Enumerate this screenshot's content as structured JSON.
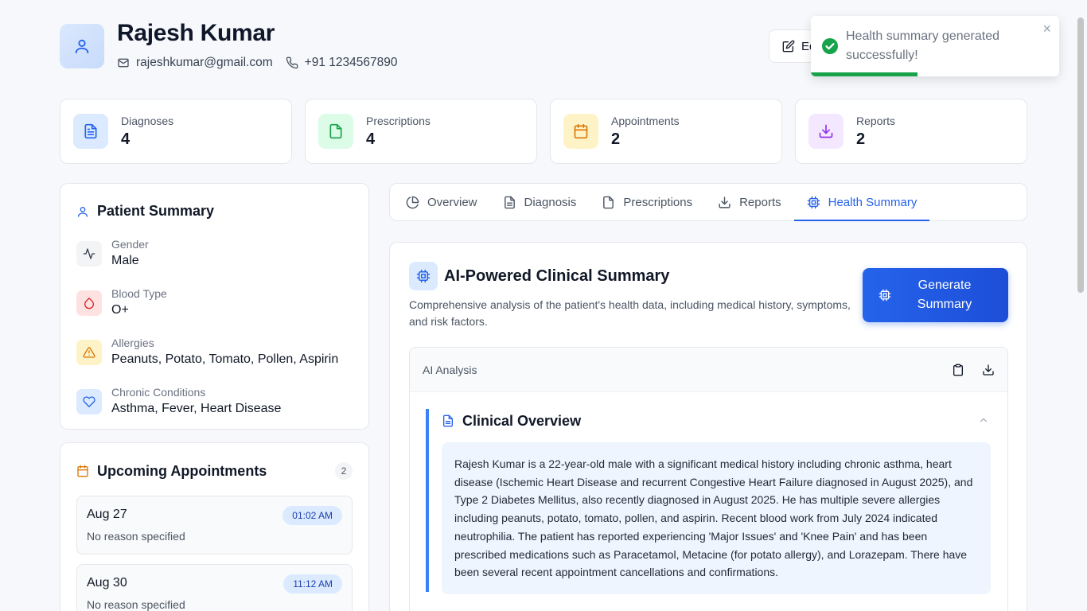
{
  "patient": {
    "name": "Rajesh Kumar",
    "email": "rajeshkumar@gmail.com",
    "phone": "+91 1234567890"
  },
  "header": {
    "edit_label": "Edit"
  },
  "toast": {
    "message": "Health summary generated successfully!",
    "close": "×",
    "progress": 0.43
  },
  "stats": [
    {
      "label": "Diagnoses",
      "value": "4",
      "icon": "file-text-icon"
    },
    {
      "label": "Prescriptions",
      "value": "4",
      "icon": "file-icon"
    },
    {
      "label": "Appointments",
      "value": "2",
      "icon": "calendar-icon"
    },
    {
      "label": "Reports",
      "value": "2",
      "icon": "download-icon"
    }
  ],
  "summary": {
    "title": "Patient Summary",
    "items": [
      {
        "label": "Gender",
        "value": "Male",
        "icon": "activity-icon"
      },
      {
        "label": "Blood Type",
        "value": "O+",
        "icon": "droplet-icon"
      },
      {
        "label": "Allergies",
        "value": "Peanuts, Potato, Tomato, Pollen, Aspirin",
        "icon": "alert-triangle-icon"
      },
      {
        "label": "Chronic Conditions",
        "value": "Asthma, Fever, Heart Disease",
        "icon": "heart-icon"
      }
    ]
  },
  "appointments": {
    "title": "Upcoming Appointments",
    "count": "2",
    "items": [
      {
        "date": "Aug 27",
        "time": "01:02 AM",
        "reason": "No reason specified"
      },
      {
        "date": "Aug 30",
        "time": "11:12 AM",
        "reason": "No reason specified"
      }
    ]
  },
  "tabs": [
    {
      "label": "Overview",
      "icon": "pie-chart-icon"
    },
    {
      "label": "Diagnosis",
      "icon": "file-text-icon"
    },
    {
      "label": "Prescriptions",
      "icon": "file-icon"
    },
    {
      "label": "Reports",
      "icon": "download-icon"
    },
    {
      "label": "Health Summary",
      "icon": "cpu-icon",
      "active": true
    }
  ],
  "main": {
    "title": "AI-Powered Clinical Summary",
    "description": "Comprehensive analysis of the patient's health data, including medical history, symptoms, and risk factors.",
    "generate_label": "Generate Summary",
    "analysis_label": "AI Analysis",
    "section_title": "Clinical Overview",
    "section_body": "Rajesh Kumar is a 22-year-old male with a significant medical history including chronic asthma, heart disease (Ischemic Heart Disease and recurrent Congestive Heart Failure diagnosed in August 2025), and Type 2 Diabetes Mellitus, also recently diagnosed in August 2025. He has multiple severe allergies including peanuts, potato, tomato, pollen, and aspirin. Recent blood work from July 2024 indicated neutrophilia. The patient has reported experiencing 'Major Issues' and 'Knee Pain' and has been prescribed medications such as Paracetamol, Metacine (for potato allergy), and Lorazepam. There have been several recent appointment cancellations and confirmations."
  },
  "colors": {
    "accent": "#2563eb",
    "success": "#16a34a"
  }
}
